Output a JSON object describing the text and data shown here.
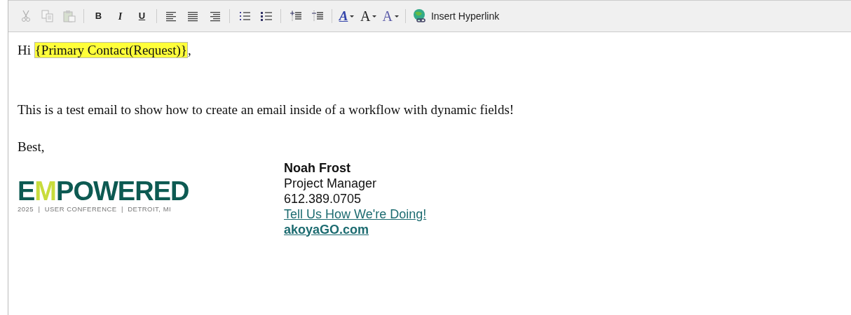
{
  "toolbar": [
    {
      "kind": "cut",
      "disabled": true
    },
    {
      "kind": "copy",
      "disabled": true
    },
    {
      "kind": "paste",
      "disabled": true
    },
    {
      "kind": "separator"
    },
    {
      "kind": "bold",
      "label": "B"
    },
    {
      "kind": "italic",
      "label": "I"
    },
    {
      "kind": "underline",
      "label": "U"
    },
    {
      "kind": "separator"
    },
    {
      "kind": "align-left"
    },
    {
      "kind": "align-center"
    },
    {
      "kind": "align-right"
    },
    {
      "kind": "separator"
    },
    {
      "kind": "numbered-list"
    },
    {
      "kind": "bullet-list"
    },
    {
      "kind": "separator"
    },
    {
      "kind": "indent"
    },
    {
      "kind": "outdent"
    },
    {
      "kind": "separator"
    },
    {
      "kind": "font-color",
      "label": "A"
    },
    {
      "kind": "font-size",
      "label": "A"
    },
    {
      "kind": "font-name",
      "label": "A"
    },
    {
      "kind": "separator"
    },
    {
      "kind": "hyperlink",
      "label": "Insert Hyperlink"
    }
  ],
  "message": {
    "greeting": "Hi",
    "field": "{Primary Contact(Request)}",
    "greeting_end": ",",
    "body": "This is a test email to show how to create an email inside of a workflow with dynamic fields!",
    "closing": "Best,"
  },
  "signature": {
    "logo": {
      "word": "EMPOWERED",
      "tagline": "2025  |  USER CONFERENCE  |  DETROIT, MI"
    },
    "name": "Noah Frost",
    "title": "Project Manager",
    "phone": "612.389.0705",
    "feedback_link": "Tell Us How We're Doing!",
    "website": "akoyaGO.com"
  }
}
